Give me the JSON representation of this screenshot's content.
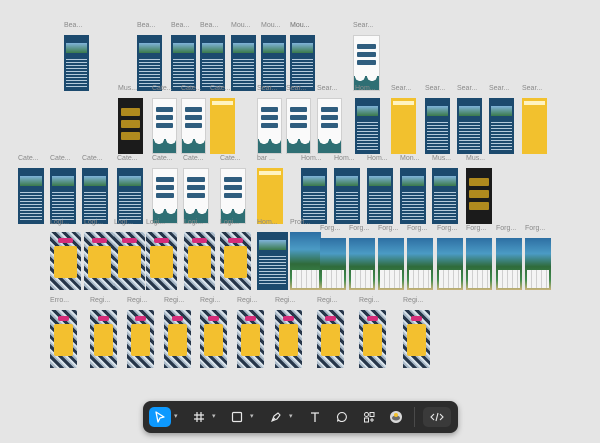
{
  "canvas": {
    "frames": [
      {
        "label": "Bea...",
        "variant": "beach"
      },
      {
        "label": "Bea...",
        "variant": "beach"
      },
      {
        "label": "Bea...",
        "variant": "beach"
      },
      {
        "label": "Bea...",
        "variant": "beach"
      },
      {
        "label": "Mou...",
        "variant": "beach"
      },
      {
        "label": "Mou...",
        "variant": "beach"
      },
      {
        "label": "Mou...",
        "variant": "beach"
      },
      {
        "label": "Mou...",
        "variant": "beach"
      },
      {
        "label": "Sear...",
        "variant": "white"
      },
      {
        "label": "Mus...",
        "variant": "dark"
      },
      {
        "label": "Cate...",
        "variant": "white"
      },
      {
        "label": "Cate...",
        "variant": "white"
      },
      {
        "label": "Cate...",
        "variant": "yellow"
      },
      {
        "label": "Sear...",
        "variant": "white"
      },
      {
        "label": "Sear...",
        "variant": "white"
      },
      {
        "label": "Sear...",
        "variant": "white"
      },
      {
        "label": "Hom...",
        "variant": "beach"
      },
      {
        "label": "Sear...",
        "variant": "yellow"
      },
      {
        "label": "Sear...",
        "variant": "beach"
      },
      {
        "label": "Sear...",
        "variant": "beach"
      },
      {
        "label": "Sear...",
        "variant": "beach"
      },
      {
        "label": "Sear...",
        "variant": "yellow"
      },
      {
        "label": "Cate...",
        "variant": "beach"
      },
      {
        "label": "Cate...",
        "variant": "beach"
      },
      {
        "label": "Cate...",
        "variant": "beach"
      },
      {
        "label": "Cate...",
        "variant": "beach"
      },
      {
        "label": "Cate...",
        "variant": "white"
      },
      {
        "label": "Cate...",
        "variant": "white"
      },
      {
        "label": "Cate...",
        "variant": "white"
      },
      {
        "label": "bar ...",
        "variant": "yellow"
      },
      {
        "label": "Hom...",
        "variant": "beach"
      },
      {
        "label": "Hom...",
        "variant": "beach"
      },
      {
        "label": "Hom...",
        "variant": "beach"
      },
      {
        "label": "Mon...",
        "variant": "beach"
      },
      {
        "label": "Mus...",
        "variant": "beach"
      },
      {
        "label": "Mus...",
        "variant": "dark"
      },
      {
        "label": "Logi...",
        "variant": "pattern"
      },
      {
        "label": "Logi...",
        "variant": "pattern"
      },
      {
        "label": "Logi...",
        "variant": "pattern"
      },
      {
        "label": "Logi...",
        "variant": "pattern"
      },
      {
        "label": "Logi...",
        "variant": "pattern"
      },
      {
        "label": "Logi...",
        "variant": "pattern"
      },
      {
        "label": "Hom...",
        "variant": "beach"
      },
      {
        "label": "Profi...",
        "variant": "island"
      },
      {
        "label": "Forg...",
        "variant": "island"
      },
      {
        "label": "Forg...",
        "variant": "island"
      },
      {
        "label": "Forg...",
        "variant": "island"
      },
      {
        "label": "Forg...",
        "variant": "island"
      },
      {
        "label": "Forg...",
        "variant": "island"
      },
      {
        "label": "Forg...",
        "variant": "island"
      },
      {
        "label": "Forg...",
        "variant": "island"
      },
      {
        "label": "Forg...",
        "variant": "island"
      },
      {
        "label": "Erro...",
        "variant": "pattern"
      },
      {
        "label": "Regi...",
        "variant": "pattern"
      },
      {
        "label": "Regi...",
        "variant": "pattern"
      },
      {
        "label": "Regi...",
        "variant": "pattern"
      },
      {
        "label": "Regi...",
        "variant": "pattern"
      },
      {
        "label": "Regi...",
        "variant": "pattern"
      },
      {
        "label": "Regi...",
        "variant": "pattern"
      },
      {
        "label": "Regi...",
        "variant": "pattern"
      },
      {
        "label": "Regi...",
        "variant": "pattern"
      },
      {
        "label": "Regi...",
        "variant": "pattern"
      }
    ]
  },
  "toolbar": {
    "tools": [
      {
        "name": "move-tool",
        "icon": "cursor-arrow-icon",
        "active": true
      },
      {
        "name": "frame-tool",
        "icon": "hash-frame-icon",
        "active": false
      },
      {
        "name": "shape-tool",
        "icon": "rectangle-icon",
        "active": false
      },
      {
        "name": "pen-tool",
        "icon": "pen-nib-icon",
        "active": false
      },
      {
        "name": "text-tool",
        "icon": "text-t-icon",
        "active": false
      },
      {
        "name": "comment-tool",
        "icon": "comment-bubble-icon",
        "active": false
      },
      {
        "name": "actions-tool",
        "icon": "components-plus-icon",
        "active": false
      },
      {
        "name": "plugin-tool",
        "icon": "avatar-plugin-icon",
        "active": false
      },
      {
        "name": "dev-mode-toggle",
        "icon": "code-brackets-icon",
        "active": false
      }
    ],
    "accent": "#0d99ff"
  }
}
